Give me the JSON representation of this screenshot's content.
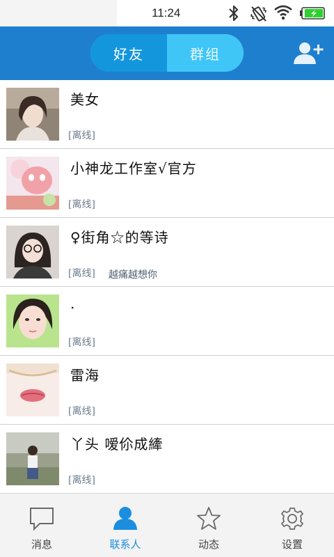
{
  "status_bar": {
    "time": "11:24",
    "icons": [
      "bluetooth-icon",
      "vibrate-icon",
      "wifi-icon",
      "battery-charging-icon"
    ]
  },
  "header": {
    "tabs": [
      {
        "label": "好友",
        "active": true
      },
      {
        "label": "群组",
        "active": false
      }
    ],
    "add_friend_icon": "add-friend-icon",
    "colors": {
      "bar": "#1f7fcf",
      "tab_active": "#1496dc",
      "tab_inactive": "#3fc6f7"
    }
  },
  "contacts": [
    {
      "name": "美女",
      "status": "[离线]",
      "signature": ""
    },
    {
      "name": "小神龙工作室√官方",
      "status": "[离线]",
      "signature": ""
    },
    {
      "name": "♀街角☆的等诗",
      "status": "[离线]",
      "signature": "越痛越想你"
    },
    {
      "name": ".",
      "status": "[离线]",
      "signature": ""
    },
    {
      "name": "雷海",
      "status": "[离线]",
      "signature": ""
    },
    {
      "name": "丫头  嗳伱成縴",
      "status": "[离线]",
      "signature": ""
    }
  ],
  "bottom_nav": [
    {
      "label": "消息",
      "icon": "message-icon",
      "active": false
    },
    {
      "label": "联系人",
      "icon": "contacts-icon",
      "active": true
    },
    {
      "label": "动态",
      "icon": "star-icon",
      "active": false
    },
    {
      "label": "设置",
      "icon": "gear-icon",
      "active": false
    }
  ],
  "accent_color": "#1b8ee0"
}
